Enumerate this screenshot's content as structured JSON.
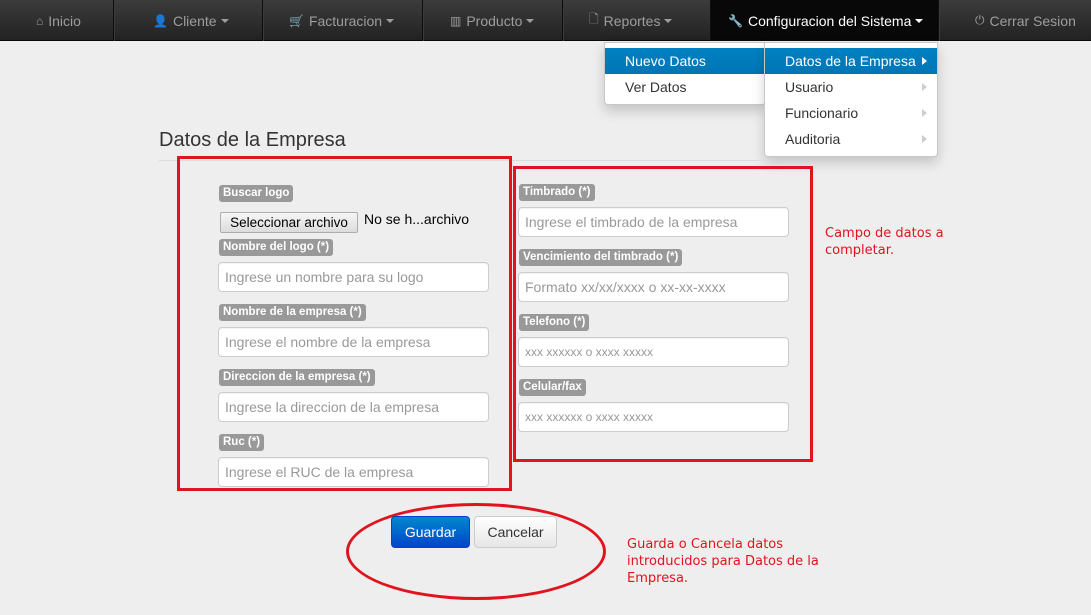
{
  "navbar": {
    "items": [
      {
        "label": "Inicio",
        "icon": "home-icon"
      },
      {
        "label": "Cliente",
        "icon": "user-icon"
      },
      {
        "label": "Facturacion",
        "icon": "cart-icon"
      },
      {
        "label": "Producto",
        "icon": "barcode-icon"
      },
      {
        "label": "Reportes",
        "icon": "file-icon"
      },
      {
        "label": "Configuracion del Sistema",
        "icon": "wrench-icon"
      },
      {
        "label": "Cerrar Sesion",
        "icon": "power-icon"
      }
    ],
    "icons": {
      "home": "⌂",
      "user": "👤",
      "cart": "🛒",
      "barcode": "▥",
      "file": "🗋",
      "wrench": "🔧",
      "power": "⏻"
    }
  },
  "dropdown_primary": {
    "items": [
      {
        "label": "Nuevo Datos"
      },
      {
        "label": "Ver Datos"
      }
    ]
  },
  "dropdown_secondary": {
    "items": [
      {
        "label": "Datos de la Empresa"
      },
      {
        "label": "Usuario"
      },
      {
        "label": "Funcionario"
      },
      {
        "label": "Auditoria"
      }
    ]
  },
  "page": {
    "title": "Datos de la Empresa"
  },
  "form_left": {
    "logo_label": "Buscar logo",
    "file_button": "Seleccionar archivo",
    "file_status": "No se h...archivo",
    "logo_name_label": "Nombre del logo (*)",
    "logo_name_placeholder": "Ingrese un nombre para su logo",
    "company_name_label": "Nombre de la empresa (*)",
    "company_name_placeholder": "Ingrese el nombre de la empresa",
    "address_label": "Direccion de la empresa (*)",
    "address_placeholder": "Ingrese la direccion de la empresa",
    "ruc_label": "Ruc (*)",
    "ruc_placeholder": "Ingrese el RUC de la empresa"
  },
  "form_right": {
    "stamp_label": "Timbrado (*)",
    "stamp_placeholder": "Ingrese el timbrado de la empresa",
    "expiry_label": "Vencimiento del timbrado (*)",
    "expiry_placeholder": "Formato xx/xx/xxxx o xx-xx-xxxx",
    "phone_label": "Telefono (*)",
    "phone_placeholder": "xxx xxxxxx o xxxx xxxxx",
    "mobile_label": "Celular/fax",
    "mobile_placeholder": "xxx xxxxxx o xxxx xxxxx"
  },
  "buttons": {
    "save": "Guardar",
    "cancel": "Cancelar"
  },
  "annotations": {
    "fields_note_line1": "Campo de datos a",
    "fields_note_line2": "completar.",
    "buttons_note_line1": "Guarda o Cancela datos",
    "buttons_note_line2": "introducidos para Datos de la",
    "buttons_note_line3": "Empresa."
  },
  "colors": {
    "annotation_red": "#e0141e",
    "active_menu_blue": "#0081c2",
    "primary_button": "#0066cc"
  }
}
